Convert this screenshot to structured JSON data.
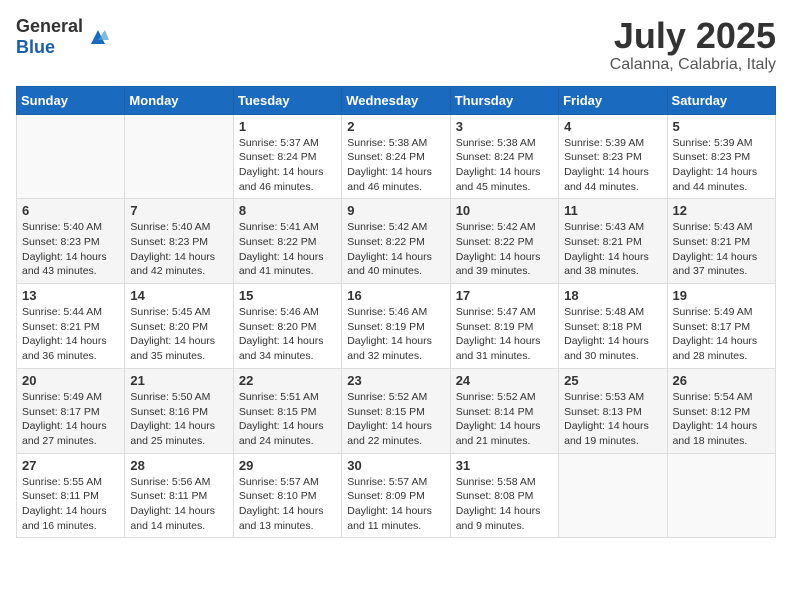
{
  "header": {
    "logo_general": "General",
    "logo_blue": "Blue",
    "title": "July 2025",
    "subtitle": "Calanna, Calabria, Italy"
  },
  "weekdays": [
    "Sunday",
    "Monday",
    "Tuesday",
    "Wednesday",
    "Thursday",
    "Friday",
    "Saturday"
  ],
  "weeks": [
    [
      {
        "day": "",
        "info": ""
      },
      {
        "day": "",
        "info": ""
      },
      {
        "day": "1",
        "info": "Sunrise: 5:37 AM\nSunset: 8:24 PM\nDaylight: 14 hours and 46 minutes."
      },
      {
        "day": "2",
        "info": "Sunrise: 5:38 AM\nSunset: 8:24 PM\nDaylight: 14 hours and 46 minutes."
      },
      {
        "day": "3",
        "info": "Sunrise: 5:38 AM\nSunset: 8:24 PM\nDaylight: 14 hours and 45 minutes."
      },
      {
        "day": "4",
        "info": "Sunrise: 5:39 AM\nSunset: 8:23 PM\nDaylight: 14 hours and 44 minutes."
      },
      {
        "day": "5",
        "info": "Sunrise: 5:39 AM\nSunset: 8:23 PM\nDaylight: 14 hours and 44 minutes."
      }
    ],
    [
      {
        "day": "6",
        "info": "Sunrise: 5:40 AM\nSunset: 8:23 PM\nDaylight: 14 hours and 43 minutes."
      },
      {
        "day": "7",
        "info": "Sunrise: 5:40 AM\nSunset: 8:23 PM\nDaylight: 14 hours and 42 minutes."
      },
      {
        "day": "8",
        "info": "Sunrise: 5:41 AM\nSunset: 8:22 PM\nDaylight: 14 hours and 41 minutes."
      },
      {
        "day": "9",
        "info": "Sunrise: 5:42 AM\nSunset: 8:22 PM\nDaylight: 14 hours and 40 minutes."
      },
      {
        "day": "10",
        "info": "Sunrise: 5:42 AM\nSunset: 8:22 PM\nDaylight: 14 hours and 39 minutes."
      },
      {
        "day": "11",
        "info": "Sunrise: 5:43 AM\nSunset: 8:21 PM\nDaylight: 14 hours and 38 minutes."
      },
      {
        "day": "12",
        "info": "Sunrise: 5:43 AM\nSunset: 8:21 PM\nDaylight: 14 hours and 37 minutes."
      }
    ],
    [
      {
        "day": "13",
        "info": "Sunrise: 5:44 AM\nSunset: 8:21 PM\nDaylight: 14 hours and 36 minutes."
      },
      {
        "day": "14",
        "info": "Sunrise: 5:45 AM\nSunset: 8:20 PM\nDaylight: 14 hours and 35 minutes."
      },
      {
        "day": "15",
        "info": "Sunrise: 5:46 AM\nSunset: 8:20 PM\nDaylight: 14 hours and 34 minutes."
      },
      {
        "day": "16",
        "info": "Sunrise: 5:46 AM\nSunset: 8:19 PM\nDaylight: 14 hours and 32 minutes."
      },
      {
        "day": "17",
        "info": "Sunrise: 5:47 AM\nSunset: 8:19 PM\nDaylight: 14 hours and 31 minutes."
      },
      {
        "day": "18",
        "info": "Sunrise: 5:48 AM\nSunset: 8:18 PM\nDaylight: 14 hours and 30 minutes."
      },
      {
        "day": "19",
        "info": "Sunrise: 5:49 AM\nSunset: 8:17 PM\nDaylight: 14 hours and 28 minutes."
      }
    ],
    [
      {
        "day": "20",
        "info": "Sunrise: 5:49 AM\nSunset: 8:17 PM\nDaylight: 14 hours and 27 minutes."
      },
      {
        "day": "21",
        "info": "Sunrise: 5:50 AM\nSunset: 8:16 PM\nDaylight: 14 hours and 25 minutes."
      },
      {
        "day": "22",
        "info": "Sunrise: 5:51 AM\nSunset: 8:15 PM\nDaylight: 14 hours and 24 minutes."
      },
      {
        "day": "23",
        "info": "Sunrise: 5:52 AM\nSunset: 8:15 PM\nDaylight: 14 hours and 22 minutes."
      },
      {
        "day": "24",
        "info": "Sunrise: 5:52 AM\nSunset: 8:14 PM\nDaylight: 14 hours and 21 minutes."
      },
      {
        "day": "25",
        "info": "Sunrise: 5:53 AM\nSunset: 8:13 PM\nDaylight: 14 hours and 19 minutes."
      },
      {
        "day": "26",
        "info": "Sunrise: 5:54 AM\nSunset: 8:12 PM\nDaylight: 14 hours and 18 minutes."
      }
    ],
    [
      {
        "day": "27",
        "info": "Sunrise: 5:55 AM\nSunset: 8:11 PM\nDaylight: 14 hours and 16 minutes."
      },
      {
        "day": "28",
        "info": "Sunrise: 5:56 AM\nSunset: 8:11 PM\nDaylight: 14 hours and 14 minutes."
      },
      {
        "day": "29",
        "info": "Sunrise: 5:57 AM\nSunset: 8:10 PM\nDaylight: 14 hours and 13 minutes."
      },
      {
        "day": "30",
        "info": "Sunrise: 5:57 AM\nSunset: 8:09 PM\nDaylight: 14 hours and 11 minutes."
      },
      {
        "day": "31",
        "info": "Sunrise: 5:58 AM\nSunset: 8:08 PM\nDaylight: 14 hours and 9 minutes."
      },
      {
        "day": "",
        "info": ""
      },
      {
        "day": "",
        "info": ""
      }
    ]
  ]
}
